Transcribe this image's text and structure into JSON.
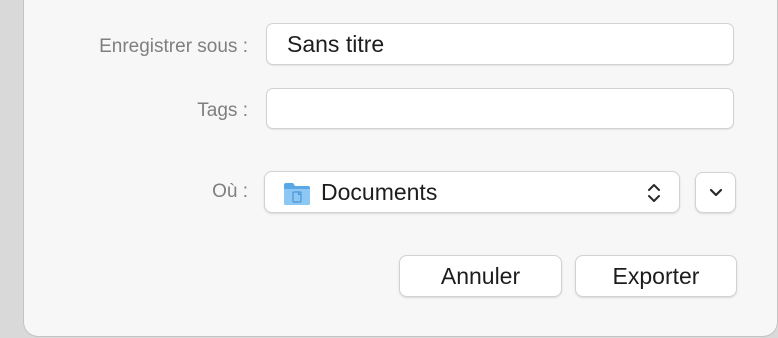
{
  "dialog": {
    "save_as_label": "Enregistrer sous :",
    "save_as_value": "Sans titre",
    "tags_label": "Tags :",
    "tags_value": "",
    "where_label": "Où :",
    "where_value": "Documents",
    "cancel_label": "Annuler",
    "export_label": "Exporter"
  },
  "icons": {
    "folder": "folder-icon",
    "popup_arrows": "updown-chevron-icon",
    "expand": "chevron-down-icon"
  },
  "colors": {
    "folder_blue": "#6fb3ea",
    "label_gray": "#7f7f7f"
  }
}
